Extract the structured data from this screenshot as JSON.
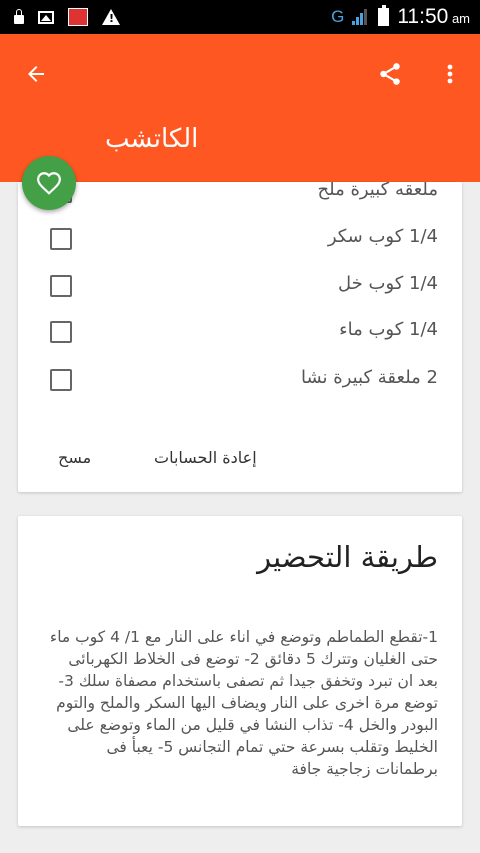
{
  "status_bar": {
    "network": "G",
    "time": "11:50",
    "ampm": "am"
  },
  "app_bar": {
    "title": "الكاتشب"
  },
  "ingredients": {
    "items": [
      {
        "text": "ملعقه كبيرة ملح",
        "checked": false
      },
      {
        "text": "1/4 كوب سكر",
        "checked": false
      },
      {
        "text": "1/4 كوب خل",
        "checked": false
      },
      {
        "text": "1/4 كوب ماء",
        "checked": false
      },
      {
        "text": "2 ملعقة كبيرة نشا",
        "checked": false
      }
    ],
    "reset_label": "إعادة الحسابات",
    "clear_label": "مسح"
  },
  "preparation": {
    "title": "طريقة التحضير",
    "body": "1-تقطع الطماطم وتوضع في اناء على النار مع 1/ 4 كوب ماء حتى الغليان وتترك 5 دقائق 2- توضع فى الخلاط الكهربائى بعد ان تبرد وتخفق جيدا ثم تصفى باستخدام مصفاة سلك 3- توضع مرة اخرى على النار ويضاف اليها السكر والملح والتوم البودر والخل 4- تذاب النشا في قليل من الماء وتوضع على الخليط وتقلب بسرعة حتي تمام التجانس 5- يعبأ فى برطمانات زجاجية جافة"
  },
  "colors": {
    "primary": "#ff5722",
    "fab": "#43a047"
  },
  "icons": [
    "back-arrow-icon",
    "share-icon",
    "more-vert-icon",
    "heart-icon"
  ]
}
